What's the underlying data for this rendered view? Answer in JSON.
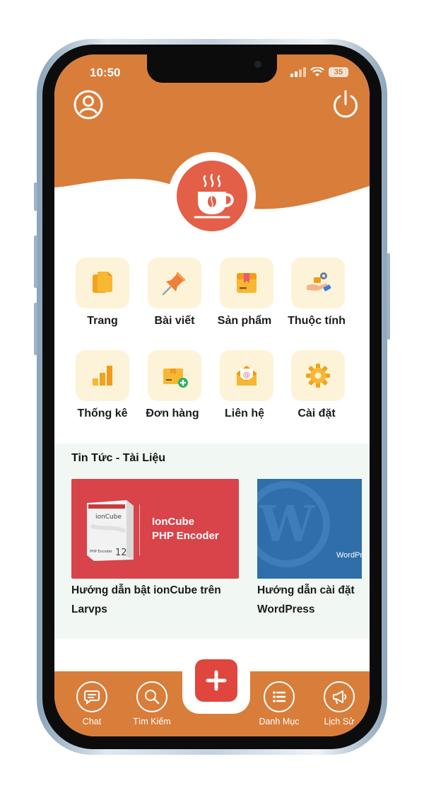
{
  "status": {
    "time": "10:50",
    "battery": "35"
  },
  "colors": {
    "primary": "#d97d3a",
    "accent": "#e35f47",
    "tile_bg": "#fdf3d8",
    "news_bg": "#f1f8f4"
  },
  "header": {
    "left_icon": "user-icon",
    "right_icon": "power-icon",
    "logo_icon": "coffee-cup-icon"
  },
  "menu": [
    {
      "label": "Trang",
      "icon": "pages-icon"
    },
    {
      "label": "Bài viết",
      "icon": "pin-icon"
    },
    {
      "label": "Sản phẩm",
      "icon": "box-icon"
    },
    {
      "label": "Thuộc tính",
      "icon": "hand-settings-icon"
    },
    {
      "label": "Thống kê",
      "icon": "bar-chart-icon"
    },
    {
      "label": "Đơn hàng",
      "icon": "order-box-icon"
    },
    {
      "label": "Liên hệ",
      "icon": "mail-icon"
    },
    {
      "label": "Cài đặt",
      "icon": "gear-icon"
    }
  ],
  "news": {
    "title": "Tin Tức - Tài Liệu",
    "cards": [
      {
        "title": "Hướng dẫn bật ionCube trên Larvps",
        "image_line1": "IonCube",
        "image_line2": "PHP Encoder",
        "box_brand": "ionCube",
        "box_label": "PHP Encoder",
        "box_version": "12"
      },
      {
        "title": "Hướng dẫn cài đặt WordPress",
        "image_text": "WordPr"
      }
    ]
  },
  "nav": [
    {
      "label": "Chat",
      "icon": "chat-icon"
    },
    {
      "label": "Tìm Kiếm",
      "icon": "search-icon"
    },
    {
      "label": "Danh Mục",
      "icon": "list-icon"
    },
    {
      "label": "Lịch Sử",
      "icon": "megaphone-icon"
    }
  ],
  "fab": {
    "icon": "plus-icon"
  }
}
